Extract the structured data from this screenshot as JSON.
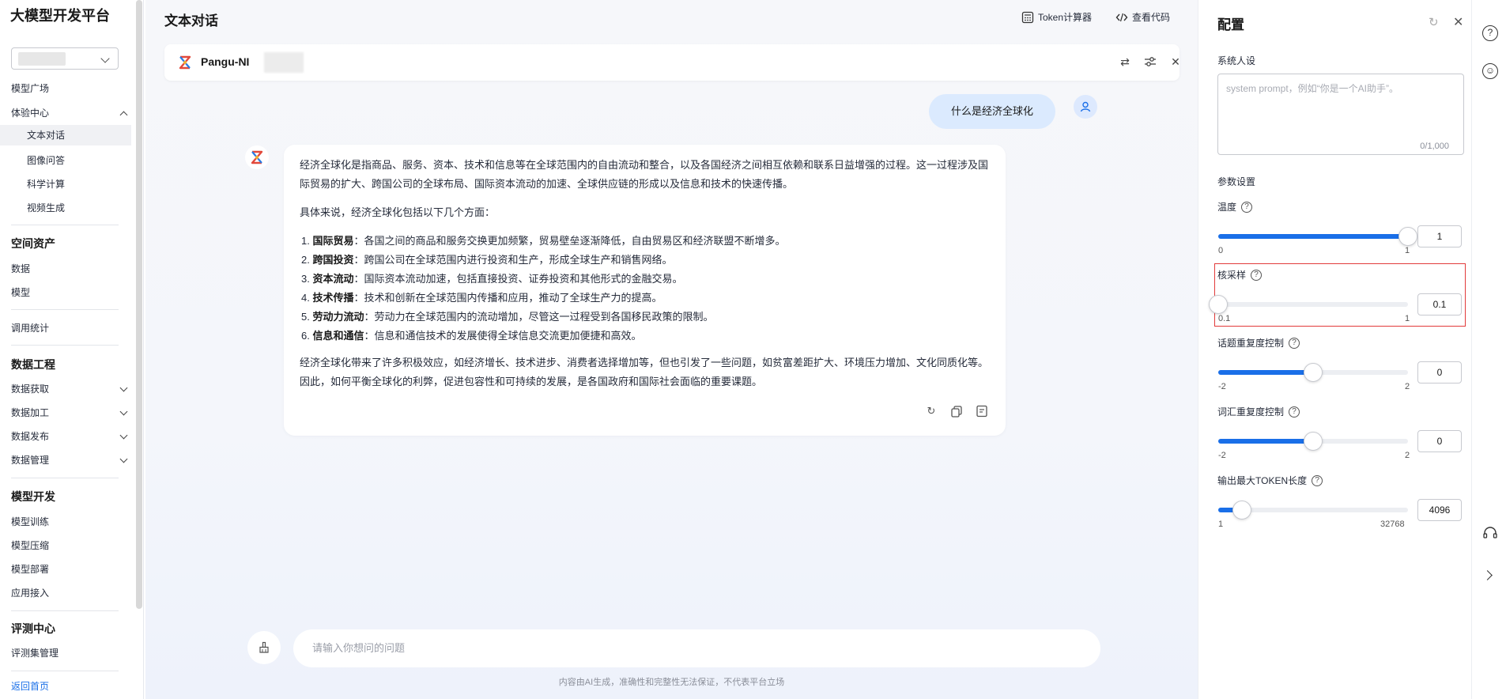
{
  "sidebar": {
    "title": "大模型开发平台",
    "items": {
      "model_square": "模型广场",
      "experience_center": "体验中心",
      "text_chat": "文本对话",
      "image_qa": "图像问答",
      "science_compute": "科学计算",
      "video_gen": "视频生成",
      "spatial_assets": "空间资产",
      "data": "数据",
      "model": "模型",
      "usage_stats": "调用统计",
      "data_engineering": "数据工程",
      "data_acquire": "数据获取",
      "data_process": "数据加工",
      "data_publish": "数据发布",
      "data_manage": "数据管理",
      "model_dev": "模型开发",
      "model_train": "模型训练",
      "model_compress": "模型压缩",
      "model_deploy": "模型部署",
      "app_access": "应用接入",
      "eval_center": "评测中心",
      "eval_set": "评测集管理",
      "back_home": "返回首页"
    }
  },
  "main": {
    "title": "文本对话",
    "token_calc": "Token计算器",
    "view_code": "查看代码",
    "model_name": "Pangu-NI",
    "user_message": "什么是经济全球化",
    "answer": {
      "p1": "经济全球化是指商品、服务、资本、技术和信息等在全球范围内的自由流动和整合，以及各国经济之间相互依赖和联系日益增强的过程。这一过程涉及国际贸易的扩大、跨国公司的全球布局、国际资本流动的加速、全球供应链的形成以及信息和技术的快速传播。",
      "p2": "具体来说，经济全球化包括以下几个方面：",
      "list": [
        {
          "num": "1.",
          "term": "国际贸易",
          "text": "：各国之间的商品和服务交换更加频繁，贸易壁垒逐渐降低，自由贸易区和经济联盟不断增多。"
        },
        {
          "num": "2.",
          "term": "跨国投资",
          "text": "：跨国公司在全球范围内进行投资和生产，形成全球生产和销售网络。"
        },
        {
          "num": "3.",
          "term": "资本流动",
          "text": "：国际资本流动加速，包括直接投资、证券投资和其他形式的金融交易。"
        },
        {
          "num": "4.",
          "term": "技术传播",
          "text": "：技术和创新在全球范围内传播和应用，推动了全球生产力的提高。"
        },
        {
          "num": "5.",
          "term": "劳动力流动",
          "text": "：劳动力在全球范围内的流动增加，尽管这一过程受到各国移民政策的限制。"
        },
        {
          "num": "6.",
          "term": "信息和通信",
          "text": "：信息和通信技术的发展使得全球信息交流更加便捷和高效。"
        }
      ],
      "p3": "经济全球化带来了许多积极效应，如经济增长、技术进步、消费者选择增加等，但也引发了一些问题，如贫富差距扩大、环境压力增加、文化同质化等。因此，如何平衡全球化的利弊，促进包容性和可持续的发展，是各国政府和国际社会面临的重要课题。"
    },
    "input_placeholder": "请输入你想问的问题",
    "disclaimer": "内容由AI生成，准确性和完整性无法保证，不代表平台立场"
  },
  "config": {
    "title": "配置",
    "system_persona_label": "系统人设",
    "system_prompt_placeholder": "system prompt，例如“你是一个AI助手”。",
    "char_counter": "0/1,000",
    "params_label": "参数设置",
    "sliders": [
      {
        "key": "temperature",
        "label": "温度",
        "min": "0",
        "max": "1",
        "value": "1",
        "fraction": 1.0
      },
      {
        "key": "top_p",
        "label": "核采样",
        "min": "0.1",
        "max": "1",
        "value": "0.1",
        "fraction": 0.0
      },
      {
        "key": "presence_penalty",
        "label": "话题重复度控制",
        "min": "-2",
        "max": "2",
        "value": "0",
        "fraction": 0.5
      },
      {
        "key": "frequency_penalty",
        "label": "词汇重复度控制",
        "min": "-2",
        "max": "2",
        "value": "0",
        "fraction": 0.5
      },
      {
        "key": "max_tokens",
        "label": "输出最大TOKEN长度",
        "min": "1",
        "max": "32768",
        "value": "4096",
        "fraction": 0.125
      }
    ],
    "accent_color": "#1a6fe8",
    "highlight_color": "#e23b3b"
  },
  "rail": {
    "help_icon": "?",
    "feedback_icon": "☺"
  }
}
